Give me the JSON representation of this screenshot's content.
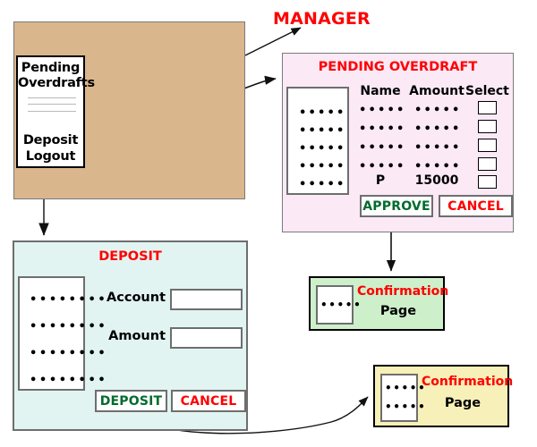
{
  "labels": {
    "manager": "MANAGER"
  },
  "customer_window": {
    "menu": {
      "items": [
        "Pending",
        "Overdrafts",
        "Deposit",
        "Logout"
      ],
      "separator_count": 3
    }
  },
  "pending_overdraft": {
    "title": "PENDING OVERDRAFT",
    "list_rows": [
      "•••••",
      "•••••",
      "•••••",
      "•••••",
      "•••••"
    ],
    "columns": [
      "Name",
      "Amount",
      "Select"
    ],
    "rows": [
      {
        "name": "•••••",
        "amount": "•••••",
        "select": false
      },
      {
        "name": "•••••",
        "amount": "•••••",
        "select": false
      },
      {
        "name": "•••••",
        "amount": "•••••",
        "select": false
      },
      {
        "name": "•••••",
        "amount": "•••••",
        "select": false
      },
      {
        "name": "P",
        "amount": "15000",
        "select": false
      }
    ],
    "approve_label": "APPROVE",
    "cancel_label": "CANCEL"
  },
  "deposit": {
    "title": "DEPOSIT",
    "list_rows": [
      "••••••••",
      "••••••••",
      "••••••••",
      "••••••••"
    ],
    "fields": [
      {
        "label": "Account",
        "value": "",
        "placeholder": ""
      },
      {
        "label": "Amount",
        "value": "",
        "placeholder": ""
      }
    ],
    "deposit_label": "DEPOSIT",
    "cancel_label": "CANCEL"
  },
  "confirmation_green": {
    "title": "Confirmation",
    "subtitle": "Page",
    "list_rows": [
      "•••••"
    ]
  },
  "confirmation_yellow": {
    "title": "Confirmation",
    "subtitle": "Page",
    "list_rows": [
      "•••••",
      "•••••"
    ]
  },
  "colors": {
    "customer_window_bg": "#d9b68c",
    "pending_panel_bg": "#fbe9f6",
    "deposit_panel_bg": "#e1f4f2",
    "confirm_green_bg": "#cdf0cb",
    "confirm_yellow_bg": "#f7f0b8",
    "accent_red": "#ff0000",
    "accent_green": "#006b2d"
  }
}
